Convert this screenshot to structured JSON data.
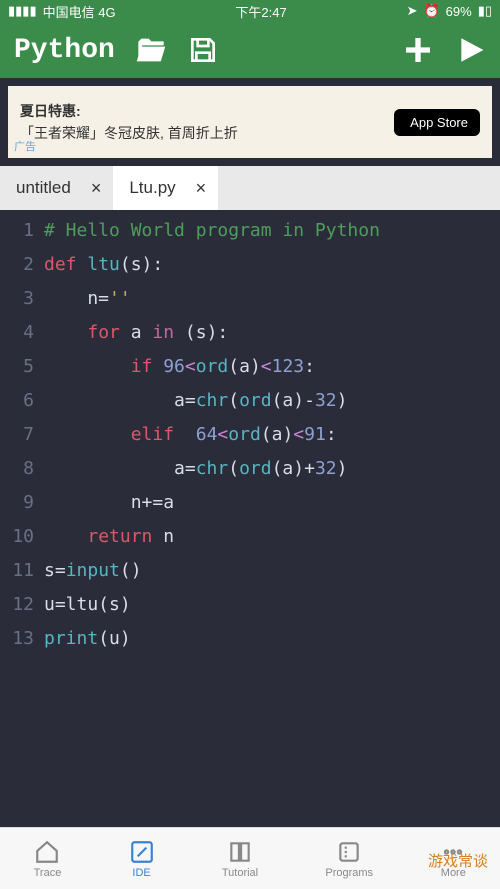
{
  "status": {
    "carrier": "中国电信  4G",
    "time": "下午2:47",
    "battery": "69%"
  },
  "header": {
    "title": "Python"
  },
  "ad": {
    "line1": "夏日特惠:",
    "line2": "「王者荣耀」冬冠皮肤, 首周折上折",
    "store": "App Store",
    "label": "广告"
  },
  "tabs": [
    {
      "label": "untitled",
      "active": false
    },
    {
      "label": "Ltu.py",
      "active": true
    }
  ],
  "code": {
    "lines": [
      {
        "n": 1,
        "tokens": [
          [
            "# Hello World program in Python",
            "c-comment"
          ]
        ]
      },
      {
        "n": 2,
        "tokens": [
          [
            "def ",
            "c-keyword"
          ],
          [
            "ltu",
            "c-func"
          ],
          [
            "(s):",
            "c-var"
          ]
        ]
      },
      {
        "n": 3,
        "tokens": [
          [
            "    n=",
            "c-var"
          ],
          [
            "''",
            "c-string"
          ]
        ]
      },
      {
        "n": 4,
        "tokens": [
          [
            "    ",
            "c-var"
          ],
          [
            "for ",
            "c-keyword"
          ],
          [
            "a ",
            "c-var"
          ],
          [
            "in ",
            "c-keyword2"
          ],
          [
            "(s):",
            "c-var"
          ]
        ]
      },
      {
        "n": 5,
        "tokens": [
          [
            "        ",
            "c-var"
          ],
          [
            "if ",
            "c-keyword"
          ],
          [
            "96",
            "c-number"
          ],
          [
            "<",
            "c-op"
          ],
          [
            "ord",
            "c-func"
          ],
          [
            "(a)",
            "c-var"
          ],
          [
            "<",
            "c-op"
          ],
          [
            "123",
            "c-number"
          ],
          [
            ":",
            "c-var"
          ]
        ]
      },
      {
        "n": 6,
        "tokens": [
          [
            "            a=",
            "c-var"
          ],
          [
            "chr",
            "c-func"
          ],
          [
            "(",
            "c-var"
          ],
          [
            "ord",
            "c-func"
          ],
          [
            "(a)-",
            "c-var"
          ],
          [
            "32",
            "c-number"
          ],
          [
            ")",
            "c-var"
          ]
        ]
      },
      {
        "n": 7,
        "tokens": [
          [
            "        ",
            "c-var"
          ],
          [
            "elif  ",
            "c-keyword"
          ],
          [
            "64",
            "c-number"
          ],
          [
            "<",
            "c-op"
          ],
          [
            "ord",
            "c-func"
          ],
          [
            "(a)",
            "c-var"
          ],
          [
            "<",
            "c-op"
          ],
          [
            "91",
            "c-number"
          ],
          [
            ":",
            "c-var"
          ]
        ]
      },
      {
        "n": 8,
        "tokens": [
          [
            "            a=",
            "c-var"
          ],
          [
            "chr",
            "c-func"
          ],
          [
            "(",
            "c-var"
          ],
          [
            "ord",
            "c-func"
          ],
          [
            "(a)+",
            "c-var"
          ],
          [
            "32",
            "c-number"
          ],
          [
            ")",
            "c-var"
          ]
        ]
      },
      {
        "n": 9,
        "tokens": [
          [
            "        n+=a",
            "c-var"
          ]
        ]
      },
      {
        "n": 10,
        "tokens": [
          [
            "    ",
            "c-var"
          ],
          [
            "return ",
            "c-keyword"
          ],
          [
            "n",
            "c-var"
          ]
        ]
      },
      {
        "n": 11,
        "tokens": [
          [
            "s=",
            "c-var"
          ],
          [
            "input",
            "c-func"
          ],
          [
            "()",
            "c-var"
          ]
        ]
      },
      {
        "n": 12,
        "tokens": [
          [
            "u=ltu(s)",
            "c-var"
          ]
        ]
      },
      {
        "n": 13,
        "tokens": [
          [
            "print",
            "c-func"
          ],
          [
            "(u)",
            "c-var"
          ]
        ]
      }
    ]
  },
  "nav": {
    "items": [
      {
        "label": "Trace"
      },
      {
        "label": "IDE"
      },
      {
        "label": "Tutorial"
      },
      {
        "label": "Programs"
      },
      {
        "label": "More"
      }
    ]
  },
  "watermark": "游戏常谈"
}
